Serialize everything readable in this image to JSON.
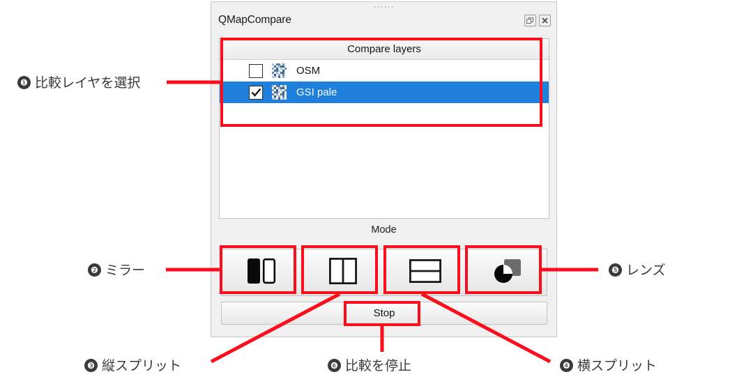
{
  "panel": {
    "title": "QMapCompare",
    "window_controls": [
      {
        "name": "undock-icon",
        "label": "Undock"
      },
      {
        "name": "close-icon",
        "label": "Close"
      }
    ],
    "layer_list": {
      "header": "Compare layers",
      "rows": [
        {
          "label": "OSM",
          "checked": false,
          "selected": false
        },
        {
          "label": "GSI pale",
          "checked": true,
          "selected": true
        }
      ]
    },
    "mode": {
      "label": "Mode",
      "buttons": [
        {
          "name": "mirror",
          "title": "Mirror"
        },
        {
          "name": "vertical-split",
          "title": "Vertical split"
        },
        {
          "name": "horizontal-split",
          "title": "Horizontal split"
        },
        {
          "name": "lens",
          "title": "Lens"
        }
      ]
    },
    "stop_button": "Stop"
  },
  "annotations": [
    {
      "num": "❶",
      "text": "比較レイヤを選択"
    },
    {
      "num": "❷",
      "text": "ミラー"
    },
    {
      "num": "❸",
      "text": "縦スプリット"
    },
    {
      "num": "❹",
      "text": "横スプリット"
    },
    {
      "num": "❺",
      "text": "レンズ"
    },
    {
      "num": "❻",
      "text": "比較を停止"
    }
  ],
  "colors": {
    "annotation_red": "#fc0d1b",
    "selection_blue": "#1f80dc",
    "panel_bg": "#f0f0f0"
  }
}
